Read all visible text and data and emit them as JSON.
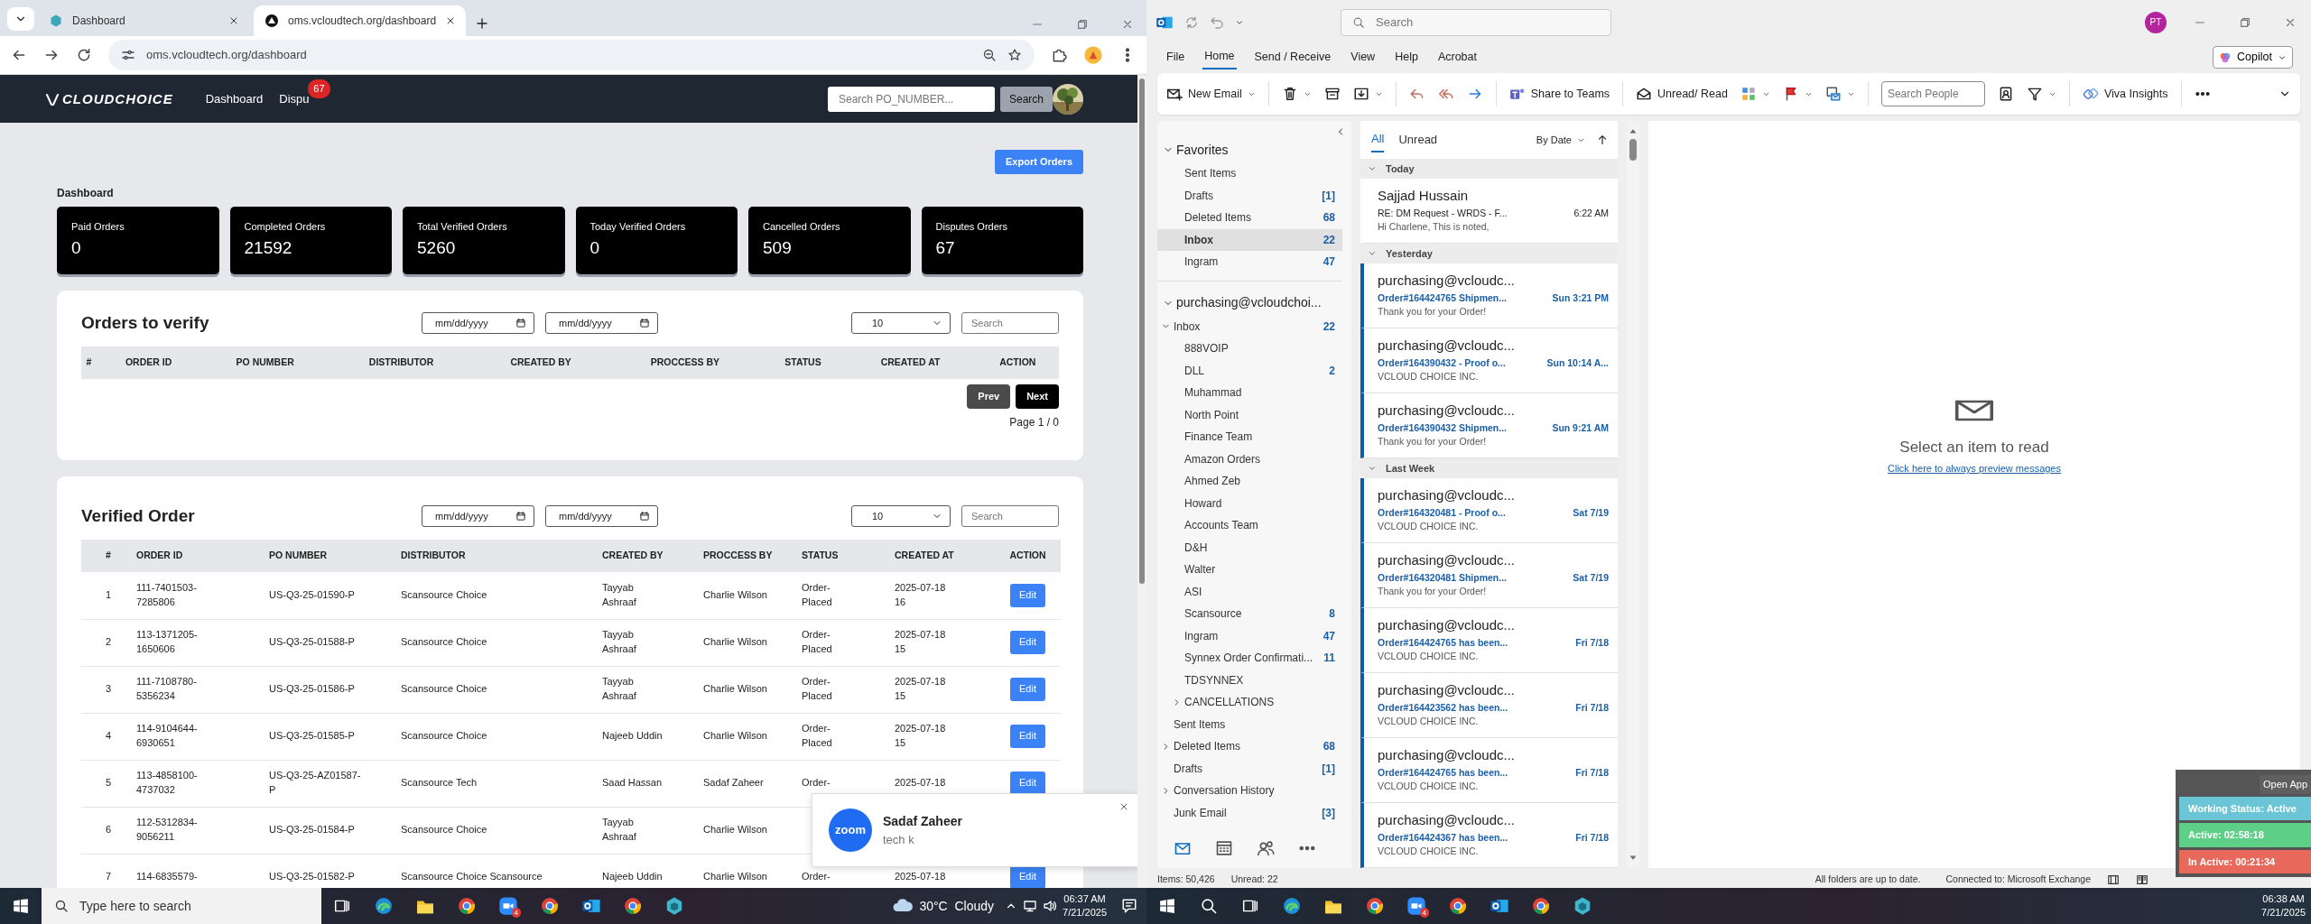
{
  "browser": {
    "tabs": [
      {
        "label": "Dashboard",
        "selected": false
      },
      {
        "label": "oms.vcloudtech.org/dashboard",
        "selected": true
      }
    ],
    "address": "oms.vcloudtech.org/dashboard"
  },
  "oms": {
    "logo": "CLOUDCHOICE",
    "nav": [
      {
        "label": "Dashboard"
      },
      {
        "label": "Dispu",
        "badge": "67"
      }
    ],
    "search": {
      "placeholder": "Search PO_NUMBER..."
    },
    "search_button": "Search",
    "export_button": "Export Orders",
    "heading": "Dashboard",
    "stats": [
      {
        "label": "Paid Orders",
        "value": "0"
      },
      {
        "label": "Completed Orders",
        "value": "21592"
      },
      {
        "label": "Total Verified Orders",
        "value": "5260"
      },
      {
        "label": "Today Verified Orders",
        "value": "0"
      },
      {
        "label": "Cancelled Orders",
        "value": "509"
      },
      {
        "label": "Disputes Orders",
        "value": "67"
      }
    ],
    "panels": [
      {
        "title": "Orders to verify",
        "date_from": "mm/dd/yyyy",
        "date_to": "mm/dd/yyyy",
        "page_size": "10",
        "search_placeholder": "Search",
        "columns": [
          "#",
          "ORDER ID",
          "PO NUMBER",
          "DISTRIBUTOR",
          "CREATED BY",
          "PROCCESS BY",
          "STATUS",
          "CREATED AT",
          "ACTION"
        ],
        "prev": "Prev",
        "next": "Next",
        "page_info": "Page 1 / 0"
      },
      {
        "title": "Verified Order",
        "date_from": "mm/dd/yyyy",
        "date_to": "mm/dd/yyyy",
        "page_size": "10",
        "search_placeholder": "Search",
        "columns": [
          "#",
          "ORDER ID",
          "PO NUMBER",
          "DISTRIBUTOR",
          "CREATED BY",
          "PROCCESS BY",
          "STATUS",
          "CREATED AT",
          "ACTION"
        ],
        "rows": [
          {
            "n": "1",
            "order_id": "111-7401503-7285806",
            "po_number": "US-Q3-25-01590-P",
            "distributor": "Scansource Choice",
            "created_by": "Tayyab Ashraaf",
            "processed_by": "Charlie Wilson",
            "status": "Order-Placed",
            "created_at": "2025-07-18 16",
            "action": "Edit"
          },
          {
            "n": "2",
            "order_id": "113-1371205-1650606",
            "po_number": "US-Q3-25-01588-P",
            "distributor": "Scansource Choice",
            "created_by": "Tayyab Ashraaf",
            "processed_by": "Charlie Wilson",
            "status": "Order-Placed",
            "created_at": "2025-07-18 15",
            "action": "Edit"
          },
          {
            "n": "3",
            "order_id": "111-7108780-5356234",
            "po_number": "US-Q3-25-01586-P",
            "distributor": "Scansource Choice",
            "created_by": "Tayyab Ashraaf",
            "processed_by": "Charlie Wilson",
            "status": "Order-Placed",
            "created_at": "2025-07-18 15",
            "action": "Edit"
          },
          {
            "n": "4",
            "order_id": "114-9104644-6930651",
            "po_number": "US-Q3-25-01585-P",
            "distributor": "Scansource Choice",
            "created_by": "Najeeb Uddin",
            "processed_by": "Charlie Wilson",
            "status": "Order-Placed",
            "created_at": "2025-07-18 15",
            "action": "Edit"
          },
          {
            "n": "5",
            "order_id": "113-4858100-4737032",
            "po_number": "US-Q3-25-AZ01587-P",
            "distributor": "Scansource Tech",
            "created_by": "Saad Hassan",
            "processed_by": "Sadaf Zaheer",
            "status": "Order-",
            "created_at": "2025-07-18",
            "action": "Edit"
          },
          {
            "n": "6",
            "order_id": "112-5312834-9056211",
            "po_number": "US-Q3-25-01584-P",
            "distributor": "Scansource Choice",
            "created_by": "Tayyab Ashraaf",
            "processed_by": "Charlie Wilson"
          },
          {
            "n": "7",
            "order_id": "114-6835579-",
            "po_number": "US-Q3-25-01582-P",
            "distributor": "Scansource Choice Scansource",
            "created_by": "Najeeb Uddin",
            "processed_by": "Charlie Wilson",
            "status": "Order-",
            "created_at": "2025-07-18",
            "action": "Edit"
          }
        ]
      }
    ]
  },
  "zoom_toast": {
    "app": "zoom",
    "name": "Sadaf Zaheer",
    "message": "tech k"
  },
  "left_taskbar": {
    "search_placeholder": "Type here to search",
    "app_badge": "4",
    "weather": "30°C  Cloudy",
    "time": "06:37 AM",
    "date": "7/21/2025"
  },
  "outlook": {
    "search_placeholder": "Search",
    "avatar": "PT",
    "menu": [
      {
        "label": "File",
        "selected": false
      },
      {
        "label": "Home",
        "selected": true
      },
      {
        "label": "Send / Receive",
        "selected": false
      },
      {
        "label": "View",
        "selected": false
      },
      {
        "label": "Help",
        "selected": false
      },
      {
        "label": "Acrobat",
        "selected": false
      }
    ],
    "copilot": "Copilot",
    "ribbon": {
      "new_email": "New Email",
      "share": "Share to Teams",
      "unread": "Unread/ Read",
      "search_people_placeholder": "Search People",
      "viva": "Viva Insights"
    },
    "favorites": {
      "title": "Favorites",
      "expanded": true,
      "items": [
        {
          "label": "Sent Items",
          "selected": false
        },
        {
          "label": "Drafts",
          "count": "[1]",
          "selected": false
        },
        {
          "label": "Deleted Items",
          "count": "68",
          "selected": false
        },
        {
          "label": "Inbox",
          "count": "22",
          "selected": true
        },
        {
          "label": "Ingram",
          "count": "47",
          "selected": false
        }
      ]
    },
    "account": {
      "title": "purchasing@vcloudchoi...",
      "expanded": true,
      "folders": [
        {
          "label": "Inbox",
          "count": "22",
          "selected": false,
          "expanded": true,
          "children": [
            {
              "label": "888VOIP",
              "selected": false
            },
            {
              "label": "DLL",
              "count": "2",
              "selected": false
            },
            {
              "label": "Muhammad",
              "selected": false
            },
            {
              "label": "North Point",
              "selected": false
            },
            {
              "label": "Finance Team",
              "selected": false
            },
            {
              "label": "Amazon Orders",
              "selected": false
            },
            {
              "label": "Ahmed Zeb",
              "selected": false
            },
            {
              "label": "Howard",
              "selected": false
            },
            {
              "label": "Accounts Team",
              "selected": false
            },
            {
              "label": "D&H",
              "selected": false
            },
            {
              "label": "Walter",
              "selected": false
            },
            {
              "label": "ASI",
              "selected": false
            },
            {
              "label": "Scansource",
              "count": "8",
              "selected": false
            },
            {
              "label": "Ingram",
              "count": "47",
              "selected": false
            },
            {
              "label": "Synnex Order Confirmati...",
              "count": "11",
              "selected": false
            },
            {
              "label": "TDSYNNEX",
              "selected": false
            },
            {
              "label": "CANCELLATIONS",
              "selected": false,
              "expanded": false
            }
          ]
        },
        {
          "label": "Sent Items",
          "selected": false
        },
        {
          "label": "Deleted Items",
          "count": "68",
          "selected": false,
          "expanded": false
        },
        {
          "label": "Drafts",
          "count": "[1]",
          "selected": false
        },
        {
          "label": "Conversation History",
          "selected": false,
          "expanded": false
        },
        {
          "label": "Junk Email",
          "count": "[3]",
          "selected": false
        }
      ]
    },
    "filters": [
      {
        "label": "All",
        "selected": true
      },
      {
        "label": "Unread",
        "selected": false
      }
    ],
    "sort": "By Date",
    "groups": [
      {
        "title": "Today",
        "expanded": true,
        "messages": [
          {
            "from": "Sajjad Hussain",
            "subject": "RE: DM Request - WRDS - F...",
            "time": "6:22 AM",
            "preview": "Hi Charlene,   This is noted,",
            "unread": false
          }
        ]
      },
      {
        "title": "Yesterday",
        "expanded": true,
        "messages": [
          {
            "from": "purchasing@vcloudc...",
            "subject": "Order#164424765 Shipmen...",
            "time": "Sun 3:21 PM",
            "preview": "Thank you for your Order!",
            "unread": true
          },
          {
            "from": "purchasing@vcloudc...",
            "subject": "Order#164390432 - Proof o...",
            "time": "Sun 10:14 A...",
            "preview": "VCLOUD CHOICE INC.",
            "unread": true
          },
          {
            "from": "purchasing@vcloudc...",
            "subject": "Order#164390432 Shipmen...",
            "time": "Sun 9:21 AM",
            "preview": "Thank you for your Order!",
            "unread": true
          }
        ]
      },
      {
        "title": "Last Week",
        "expanded": true,
        "messages": [
          {
            "from": "purchasing@vcloudc...",
            "subject": "Order#164320481 - Proof o...",
            "time": "Sat 7/19",
            "preview": "VCLOUD CHOICE INC.",
            "unread": true
          },
          {
            "from": "purchasing@vcloudc...",
            "subject": "Order#164320481 Shipmen...",
            "time": "Sat 7/19",
            "preview": "Thank you for your Order!",
            "unread": true
          },
          {
            "from": "purchasing@vcloudc...",
            "subject": "Order#164424765 has been...",
            "time": "Fri 7/18",
            "preview": "VCLOUD CHOICE INC.",
            "unread": true
          },
          {
            "from": "purchasing@vcloudc...",
            "subject": "Order#164423562 has been...",
            "time": "Fri 7/18",
            "preview": "VCLOUD CHOICE INC.",
            "unread": true
          },
          {
            "from": "purchasing@vcloudc...",
            "subject": "Order#164424765 has been...",
            "time": "Fri 7/18",
            "preview": "VCLOUD CHOICE INC.",
            "unread": true
          },
          {
            "from": "purchasing@vcloudc...",
            "subject": "Order#164424367 has been...",
            "time": "Fri 7/18",
            "preview": "VCLOUD CHOICE INC.",
            "unread": true
          }
        ]
      }
    ],
    "reading_pane": {
      "message": "Select an item to read",
      "link": "Click here to always preview messages"
    },
    "status_bar": {
      "items": "Items: 50,426",
      "unread": "Unread: 22",
      "sync": "All folders are up to date.",
      "connection": "Connected to: Microsoft Exchange"
    }
  },
  "tracker": {
    "open_button": "Open App",
    "entries": [
      {
        "label": "Working Status: Active",
        "color": "#6cc5d6"
      },
      {
        "label": "Active: 02:58:18",
        "color": "#5dcf86"
      },
      {
        "label": "In Active: 00:21:34",
        "color": "#e8695b"
      }
    ]
  },
  "right_taskbar": {
    "app_badge": "4",
    "time": "06:38 AM",
    "date": "7/21/2025"
  }
}
